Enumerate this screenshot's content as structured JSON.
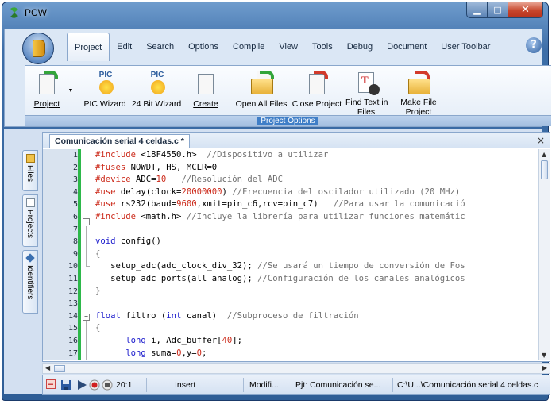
{
  "window": {
    "title": "PCW"
  },
  "ribbon": {
    "tabs": [
      {
        "label": "Project",
        "active": true
      },
      {
        "label": "Edit"
      },
      {
        "label": "Search"
      },
      {
        "label": "Options"
      },
      {
        "label": "Compile"
      },
      {
        "label": "View"
      },
      {
        "label": "Tools"
      },
      {
        "label": "Debug"
      },
      {
        "label": "Document"
      },
      {
        "label": "User Toolbar"
      }
    ],
    "help_label": "?",
    "buttons": {
      "project": "Project",
      "pic_wizard": "PIC Wizard",
      "wizard_24bit": "24 Bit Wizard",
      "create": "Create",
      "open_all": "Open All Files",
      "close_project": "Close Project",
      "find_text_1": "Find Text in",
      "find_text_2": "Files",
      "make_file_1": "Make File",
      "make_file_2": "Project",
      "pic_badge": "PIC"
    },
    "group_label": "Project Options"
  },
  "side_tabs": [
    "Files",
    "Projects",
    "Identifiers"
  ],
  "editor": {
    "tab_title": "Comunicación serial 4 celdas.c *",
    "close_glyph": "×",
    "lines": [
      {
        "n": "1",
        "parts": [
          [
            "#include",
            "pp"
          ],
          [
            " <18F4550.h>  ",
            "hdr"
          ],
          [
            "//Dispositivo a utilizar",
            "cm"
          ]
        ]
      },
      {
        "n": "2",
        "parts": [
          [
            "#fuses",
            "pp"
          ],
          [
            " NOWDT, HS, MCLR=0",
            "tx"
          ]
        ]
      },
      {
        "n": "3",
        "parts": [
          [
            "#device",
            "pp"
          ],
          [
            " ADC=",
            "tx"
          ],
          [
            "10",
            "num"
          ],
          [
            "   ",
            "tx"
          ],
          [
            "//Resolución del ADC",
            "cm"
          ]
        ]
      },
      {
        "n": "4",
        "parts": [
          [
            "#use",
            "pp"
          ],
          [
            " delay(clock=",
            "tx"
          ],
          [
            "20000000",
            "num"
          ],
          [
            ") ",
            "tx"
          ],
          [
            "//Frecuencia del oscilador utilizado (20 MHz)",
            "cm"
          ]
        ]
      },
      {
        "n": "5",
        "parts": [
          [
            "#use",
            "pp"
          ],
          [
            " rs232(baud=",
            "tx"
          ],
          [
            "9600",
            "num"
          ],
          [
            ",xmit=pin_c6,rcv=pin_c7)   ",
            "tx"
          ],
          [
            "//Para usar la comunicació",
            "cm"
          ]
        ]
      },
      {
        "n": "6",
        "parts": [
          [
            "#include",
            "pp"
          ],
          [
            " <math.h> ",
            "hdr"
          ],
          [
            "//Incluye la librería para utilizar funciones matemátic",
            "cm"
          ]
        ]
      },
      {
        "n": "7",
        "parts": []
      },
      {
        "n": "8",
        "parts": [
          [
            "void",
            "kw"
          ],
          [
            " config()",
            "tx"
          ]
        ]
      },
      {
        "n": "9",
        "parts": [
          [
            "{",
            "br"
          ]
        ]
      },
      {
        "n": "10",
        "parts": [
          [
            "   setup_adc(adc_clock_div_32); ",
            "tx"
          ],
          [
            "//Se usará un tiempo de conversión de Fos",
            "cm"
          ]
        ]
      },
      {
        "n": "11",
        "parts": [
          [
            "   setup_adc_ports(all_analog); ",
            "tx"
          ],
          [
            "//Configuración de los canales analógicos",
            "cm"
          ]
        ]
      },
      {
        "n": "12",
        "parts": [
          [
            "}",
            "br"
          ]
        ]
      },
      {
        "n": "13",
        "parts": []
      },
      {
        "n": "14",
        "parts": [
          [
            "float",
            "kw"
          ],
          [
            " filtro (",
            "tx"
          ],
          [
            "int",
            "kw"
          ],
          [
            " canal)  ",
            "tx"
          ],
          [
            "//Subproceso de filtración",
            "cm"
          ]
        ]
      },
      {
        "n": "15",
        "parts": [
          [
            "{",
            "br"
          ]
        ]
      },
      {
        "n": "16",
        "parts": [
          [
            "      ",
            "tx"
          ],
          [
            "long",
            "kw"
          ],
          [
            " i, Adc_buffer[",
            "tx"
          ],
          [
            "40",
            "num"
          ],
          [
            "];",
            "tx"
          ]
        ]
      },
      {
        "n": "17",
        "parts": [
          [
            "      ",
            "tx"
          ],
          [
            "long",
            "kw"
          ],
          [
            " suma=",
            "tx"
          ],
          [
            "0",
            "num"
          ],
          [
            ",y=",
            "tx"
          ],
          [
            "0",
            "num"
          ],
          [
            ";",
            "tx"
          ]
        ]
      }
    ]
  },
  "status": {
    "position": "20:1",
    "mode": "Insert",
    "modified": "Modifi...",
    "project": "Pjt: Comunicación se...",
    "path": "C:\\U...\\Comunicación serial 4 celdas.c"
  },
  "colors": {
    "preprocessor": "#cc2a1a",
    "keyword": "#1a1acc",
    "comment": "#707070",
    "number": "#cc2a1a",
    "text": "#000000",
    "brace": "#808080",
    "gutter_modified": "#2db84a"
  }
}
